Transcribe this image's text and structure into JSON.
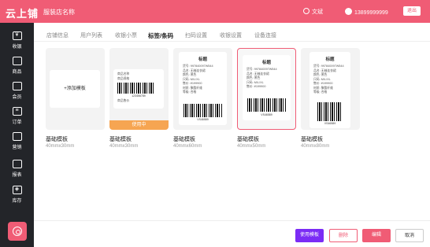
{
  "header": {
    "logo": "云上铺",
    "store_name": "服装店名称",
    "user_name": "文斌",
    "phone": "13899999999",
    "logout_label": "退出",
    "brand_color": "#f05c75"
  },
  "sidebar": {
    "items": [
      {
        "label": "收银",
        "icon": "yen-icon"
      },
      {
        "label": "商品",
        "icon": "bag-icon"
      },
      {
        "label": "会员",
        "icon": "member-icon"
      },
      {
        "label": "订单",
        "icon": "order-icon"
      },
      {
        "label": "营销",
        "icon": "marketing-icon"
      },
      {
        "label": "报表",
        "icon": "report-icon"
      },
      {
        "label": "库存",
        "icon": "stock-icon"
      }
    ],
    "settings_icon": "settings-icon"
  },
  "tabs": [
    "店铺信息",
    "用户列表",
    "收银小票",
    "标签/条码",
    "扫码设置",
    "收银设置",
    "设备连接"
  ],
  "active_tab": "标签/条码",
  "add_template_label": "+添加模板",
  "in_use_label": "使用中",
  "label_content": {
    "title": "标题",
    "lines_full": [
      "货号: 997840097W544",
      "品名: 无袖连衣裙",
      "颜色: 黑色",
      "尺码: M/L/XL",
      "售价: ¥199900",
      "材质: 聚酯纤维",
      "等级: 合格"
    ],
    "lines_small": [
      "商品名称",
      "商品规格"
    ],
    "small_price": "商品售价",
    "barcode_number": "123456789",
    "barcode_number_2": "VS46589"
  },
  "templates": [
    {
      "name": "基础模板",
      "size": "40mmx30mm"
    },
    {
      "name": "基础模板",
      "size": "40mmx30mm"
    },
    {
      "name": "基础模板",
      "size": "40mmx60mm"
    },
    {
      "name": "基础模板",
      "size": "40mmx50mm"
    },
    {
      "name": "基础模板",
      "size": "40mmx80mm"
    }
  ],
  "footer": {
    "use_label": "使用模板",
    "delete_label": "删除",
    "edit_label": "编辑",
    "cancel_label": "取消",
    "use_color": "#7b2cf5"
  }
}
